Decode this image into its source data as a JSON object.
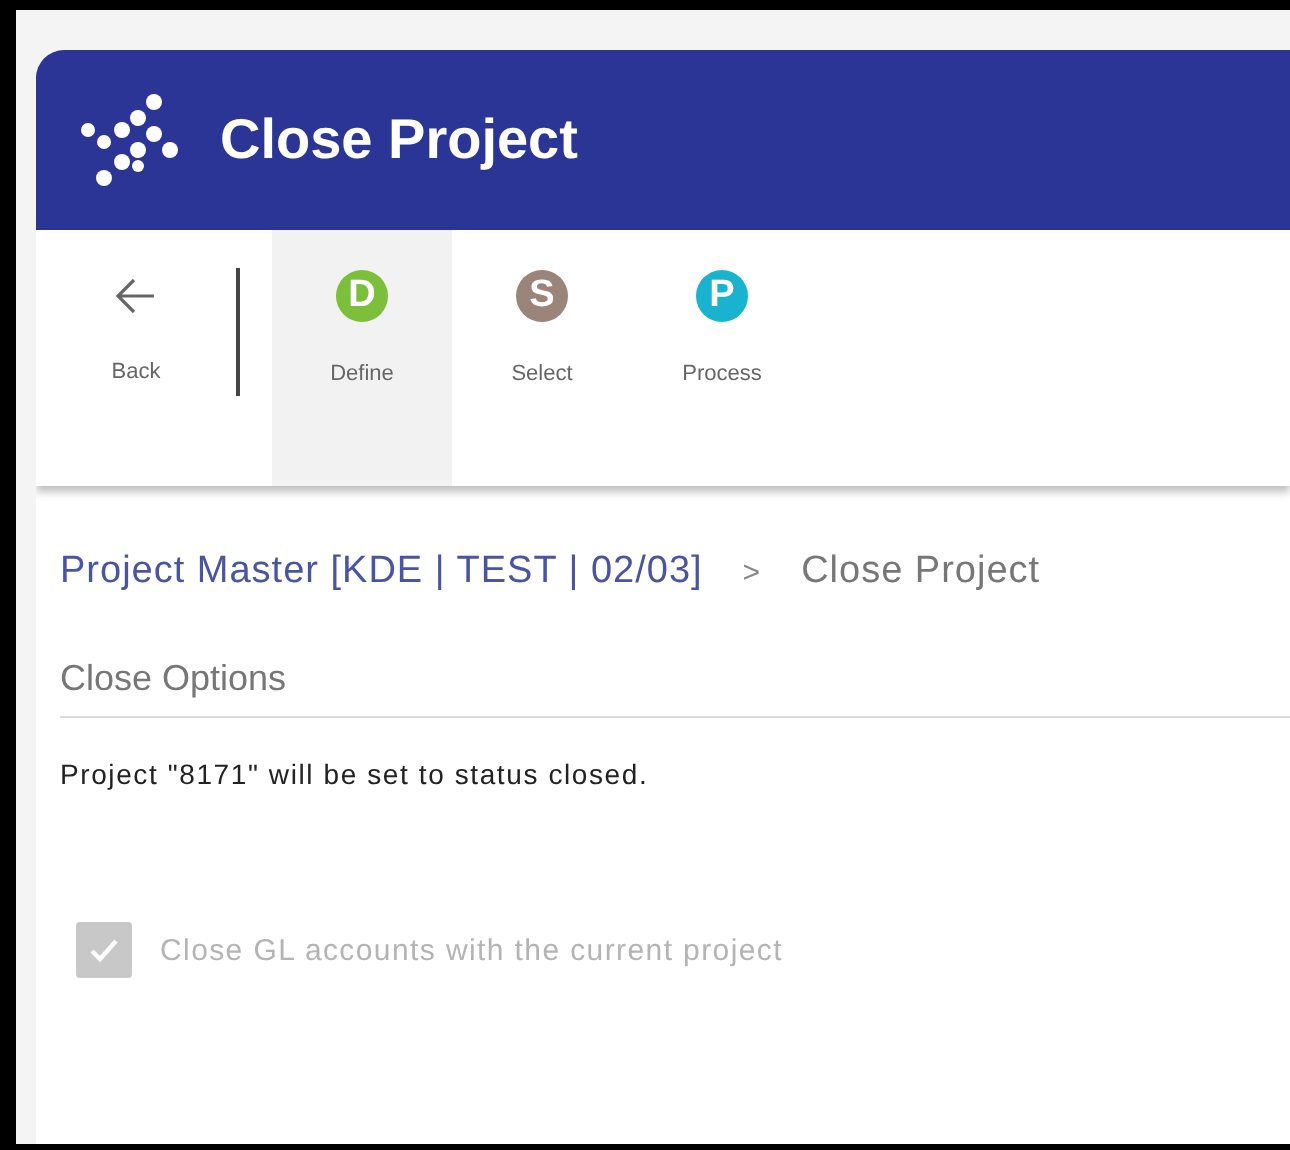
{
  "header": {
    "title": "Close Project"
  },
  "toolbar": {
    "back": {
      "label": "Back"
    },
    "steps": [
      {
        "letter": "D",
        "label": "Define",
        "color": "#7cbf3a",
        "selected": true
      },
      {
        "letter": "S",
        "label": "Select",
        "color": "#9b857a",
        "selected": false
      },
      {
        "letter": "P",
        "label": "Process",
        "color": "#1ab3cf",
        "selected": false
      }
    ]
  },
  "breadcrumb": {
    "link": "Project Master [KDE | TEST | 02/03]",
    "separator": ">",
    "current": "Close Project"
  },
  "section": {
    "title": "Close Options",
    "message": "Project \"8171\" will be set to status closed.",
    "checkbox": {
      "label": "Close GL accounts with the current project",
      "checked": true,
      "disabled": true
    }
  }
}
